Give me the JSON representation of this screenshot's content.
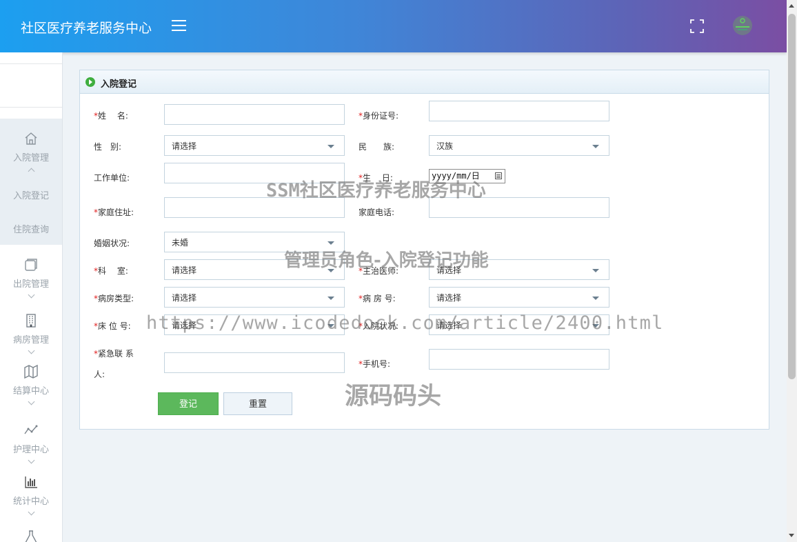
{
  "header": {
    "brand": "社区医疗养老服务中心"
  },
  "sidebar": {
    "group_admission": {
      "label": "入院管理",
      "items": [
        {
          "label": "入院登记"
        },
        {
          "label": "住院查询"
        }
      ]
    },
    "items": [
      {
        "label": "出院管理"
      },
      {
        "label": "病房管理"
      },
      {
        "label": "结算中心"
      },
      {
        "label": "护理中心"
      },
      {
        "label": "统计中心"
      }
    ]
  },
  "panel": {
    "title": "入院登记"
  },
  "form": {
    "required_mark": "*",
    "name": {
      "label": "姓　 名:",
      "value": ""
    },
    "id_card": {
      "label": "身份证号:",
      "value": ""
    },
    "gender": {
      "label": "性　别:",
      "value": "请选择"
    },
    "ethnicity": {
      "label": "民　　族:",
      "value": "汉族"
    },
    "work_unit": {
      "label": "工作单位:",
      "value": ""
    },
    "birthday": {
      "label": "生　 日:",
      "value": "yyyy/mm/日"
    },
    "home_address": {
      "label": "家庭住址:",
      "value": ""
    },
    "home_phone": {
      "label": "家庭电话:",
      "value": ""
    },
    "marital_status": {
      "label": "婚姻状况:",
      "value": "未婚"
    },
    "department": {
      "label": "科　 室:",
      "value": "请选择"
    },
    "attending_doctor": {
      "label": "主治医师:",
      "value": "请选择"
    },
    "ward_type": {
      "label": "病房类型:",
      "value": "请选择"
    },
    "ward_no": {
      "label": "病 房 号:",
      "value": "请选择"
    },
    "bed_no": {
      "label": "床 位 号:",
      "value": "请选择"
    },
    "admission_status": {
      "label": "入院状况:",
      "value": "请选择"
    },
    "emergency_contact": {
      "label_line1": "紧急联 系",
      "label_line2": "人:",
      "value": ""
    },
    "mobile": {
      "label": "手机号:",
      "value": ""
    }
  },
  "buttons": {
    "submit": "登记",
    "reset": "重置"
  },
  "watermarks": {
    "title": "SSM社区医疗养老服务中心",
    "subtitle": "管理员角色-入院登记功能",
    "url": "https://www.icodedock.com/article/2400.html",
    "brand": "源码码头"
  }
}
